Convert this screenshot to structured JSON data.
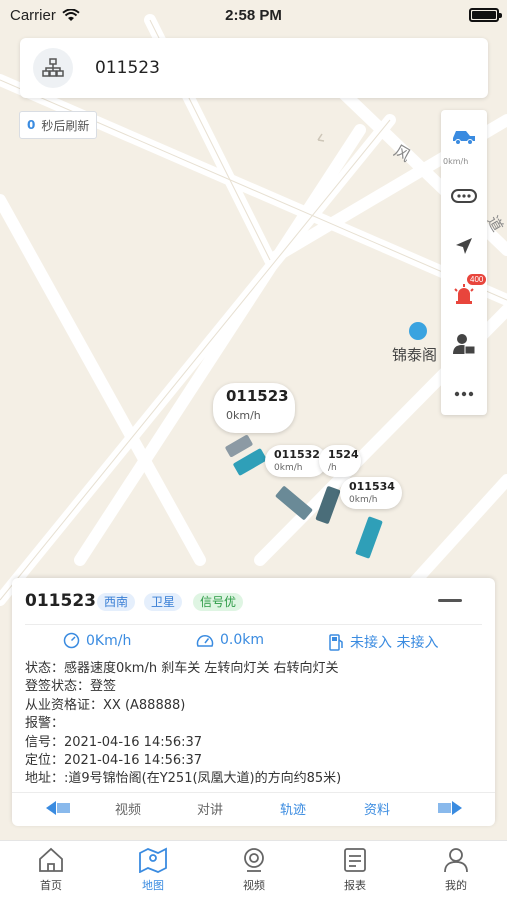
{
  "status_bar": {
    "carrier": "Carrier",
    "time": "2:58 PM"
  },
  "search": {
    "vehicle_id": "011523"
  },
  "refresh": {
    "count": "0",
    "label": "秒后刷新"
  },
  "map": {
    "road_label": "风",
    "road_label2": "道",
    "poi_name": "锦泰阁",
    "toolbar_badge": "400",
    "speed_hint": "0km/h"
  },
  "vehicles": [
    {
      "plate": "011523",
      "speed": "0km/h"
    },
    {
      "plate": "011532",
      "speed": "0km/h"
    },
    {
      "plate": "1524",
      "speed": "/h"
    },
    {
      "plate": "011534",
      "speed": "0km/h"
    }
  ],
  "info_card": {
    "plate": "011523",
    "tags": [
      "西南",
      "卫星",
      "信号优"
    ],
    "speed": "0Km/h",
    "distance": "0.0km",
    "fuel": "未接入 未接入",
    "lines": [
      "状态：感器速度0km/h 刹车关 左转向灯关 右转向灯关",
      "登签状态：登签",
      "从业资格证：XX (A88888)",
      "报警：",
      "信号：2021-04-16 14:56:37",
      "定位：2021-04-16 14:56:37",
      "地址：:道9号锦怡阁(在Y251(凤凰大道)的方向约85米)"
    ],
    "actions": [
      "视频",
      "对讲",
      "轨迹",
      "资料"
    ]
  },
  "tabs": [
    "首页",
    "地图",
    "视频",
    "报表",
    "我的"
  ],
  "colors": {
    "accent": "#3a8be0",
    "map_bg": "#f4efe5",
    "road": "#ffffff",
    "alert": "#e8453c"
  }
}
